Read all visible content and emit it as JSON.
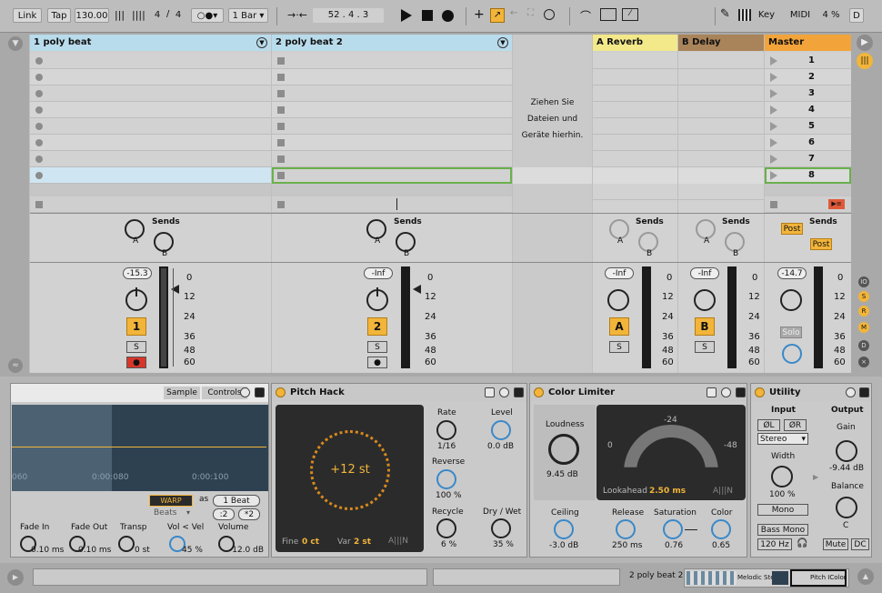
{
  "toolbar": {
    "link": "Link",
    "tap": "Tap",
    "tempo": "130.00",
    "sig_num": "4",
    "sig_den": "4",
    "quant": "1 Bar",
    "position": "52 .   4 .   3",
    "key": "Key",
    "midi": "MIDI",
    "cpu": "4 %",
    "d": "D"
  },
  "tracks": [
    {
      "name": "1 poly beat",
      "color": "#b9dcec",
      "vol": "-15.3",
      "num": "1"
    },
    {
      "name": "2 poly beat 2",
      "color": "#b9dcec",
      "vol": "-Inf",
      "num": "2"
    },
    {
      "name": "A Reverb",
      "color": "#f3e88a",
      "vol": "-Inf",
      "num": "A"
    },
    {
      "name": "B Delay",
      "color": "#a9835a",
      "vol": "-Inf",
      "num": "B"
    },
    {
      "name": "Master",
      "color": "#f2a43a",
      "vol": "-14.7"
    }
  ],
  "drop_text": {
    "l1": "Ziehen Sie",
    "l2": "Dateien und",
    "l3": "Geräte hierhin."
  },
  "scenes": [
    "1",
    "2",
    "3",
    "4",
    "5",
    "6",
    "7",
    "8"
  ],
  "mixer": {
    "sends": "Sends",
    "s": "S",
    "solo": "Solo",
    "post": "Post",
    "a": "A",
    "b": "B",
    "ticks": [
      "0",
      "12",
      "24",
      "36",
      "48",
      "60"
    ]
  },
  "clip": {
    "sample_tab": "Sample",
    "controls_tab": "Controls",
    "t1": "060",
    "t2": "0:00:080",
    "t3": "0:00:100",
    "warp": "WARP",
    "as": "as",
    "beat": "1 Beat",
    "beats": "Beats",
    "half": ":2",
    "dbl": "*2",
    "fade_in_l": "Fade In",
    "fade_in_v": "0.10 ms",
    "fade_out_l": "Fade Out",
    "fade_out_v": "0.10 ms",
    "transp_l": "Transp",
    "transp_v": "0 st",
    "vel_l": "Vol < Vel",
    "vel_v": "45 %",
    "volume_l": "Volume",
    "volume_v": "-12.0 dB"
  },
  "pitch_hack": {
    "title": "Pitch Hack",
    "center": "+12 st",
    "fine_l": "Fine",
    "fine_v": "0 ct",
    "var_l": "Var",
    "var_v": "2 st",
    "logo": "A|||N",
    "rate_l": "Rate",
    "rate_v": "1/16",
    "level_l": "Level",
    "level_v": "0.0 dB",
    "reverse_l": "Reverse",
    "reverse_v": "100 %",
    "recycle_l": "Recycle",
    "recycle_v": "6 %",
    "drywet_l": "Dry / Wet",
    "drywet_v": "35 %"
  },
  "color_limiter": {
    "title": "Color Limiter",
    "loudness_l": "Loudness",
    "loudness_v": "9.45 dB",
    "m24": "-24",
    "m0": "0",
    "m48": "-48",
    "lookahead_l": "Lookahead",
    "lookahead_v": "2.50 ms",
    "logo": "A|||N",
    "ceiling_l": "Ceiling",
    "ceiling_v": "-3.0 dB",
    "release_l": "Release",
    "release_v": "250 ms",
    "saturation_l": "Saturation",
    "saturation_v": "0.76",
    "color_l": "Color",
    "color_v": "0.65"
  },
  "utility": {
    "title": "Utility",
    "input_l": "Input",
    "output_l": "Output",
    "phase_l": "ØL",
    "phase_r": "ØR",
    "stereo": "Stereo",
    "gain_l": "Gain",
    "gain_v": "-9.44 dB",
    "width_l": "Width",
    "width_v": "100 %",
    "mono": "Mono",
    "balance_l": "Balance",
    "balance_v": "C",
    "bass_mono": "Bass Mono",
    "freq": "120 Hz",
    "mute": "Mute",
    "dc": "DC"
  },
  "status": {
    "track": "2 poly beat 2",
    "clip1": "Melodic Ste",
    "clip2": "Pitch IColor"
  }
}
